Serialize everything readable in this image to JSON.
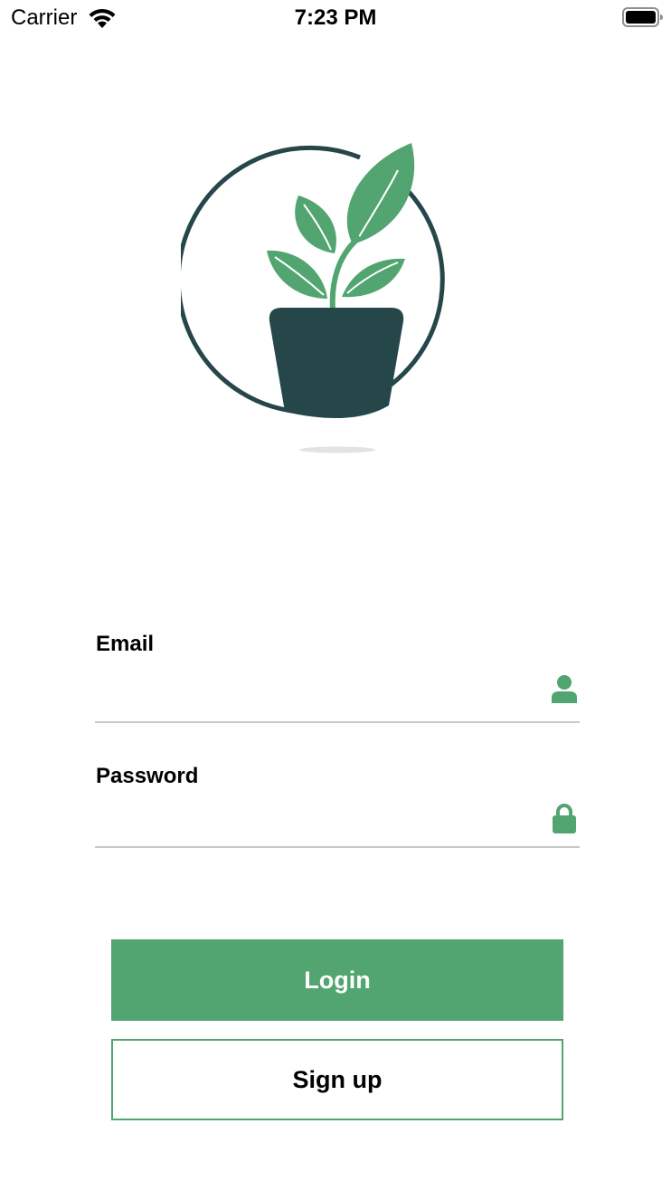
{
  "status_bar": {
    "carrier": "Carrier",
    "time": "7:23 PM"
  },
  "logo": {
    "icon": "potted-plant-logo",
    "colors": {
      "leaf": "#52a570",
      "pot": "#25474a",
      "ring": "#25474a"
    }
  },
  "form": {
    "email": {
      "label": "Email",
      "value": "",
      "placeholder": "",
      "icon": "person-icon"
    },
    "password": {
      "label": "Password",
      "value": "",
      "placeholder": "",
      "icon": "lock-icon"
    }
  },
  "buttons": {
    "login_label": "Login",
    "signup_label": "Sign up"
  },
  "colors": {
    "accent": "#52a570",
    "dark": "#25474a",
    "divider": "#c8c8c8"
  }
}
